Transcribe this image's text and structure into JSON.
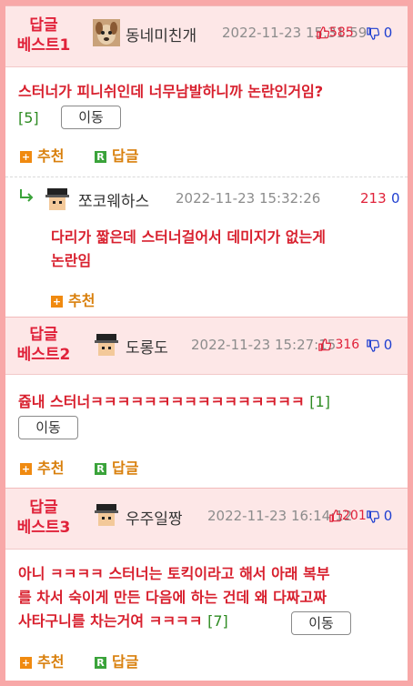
{
  "posts": [
    {
      "best_label_1": "답글",
      "best_label_2": "베스트1",
      "nickname": "동네미친개",
      "date": "2022-11-23 15:31:59",
      "up": "585",
      "down": "0",
      "text": "스터너가 피니쉬인데 너무남발하니까 논란인거임?",
      "reply_count": "[5]",
      "move_label": "이동",
      "recommend_label": "추천",
      "reply_label": "답글"
    },
    {
      "nickname": "쪼코웨하스",
      "date": "2022-11-23 15:32:26",
      "up": "213",
      "down": "0",
      "text_line1": "다리가 짧은데 스터너걸어서 데미지가 없는게",
      "text_line2": "논란임",
      "recommend_label": "추천"
    },
    {
      "best_label_1": "답글",
      "best_label_2": "베스트2",
      "nickname": "도롱도",
      "date": "2022-11-23 15:27:15",
      "up": "316",
      "down": "0",
      "text": "쥽내 스터너ㅋㅋㅋㅋㅋㅋㅋㅋㅋㅋㅋㅋㅋㅋㅋㅋ",
      "reply_count": "[1]",
      "move_label": "이동",
      "recommend_label": "추천",
      "reply_label": "답글"
    },
    {
      "best_label_1": "답글",
      "best_label_2": "베스트3",
      "nickname": "우주일짱",
      "date": "2022-11-23 16:14:12",
      "up": "201",
      "down": "0",
      "text_line1": "아니 ㅋㅋㅋㅋ 스터너는 토킥이라고 해서 아래 복부",
      "text_line2": "를 차서 숙이게 만든 다음에 하는 건데 왜 다짜고짜",
      "text_line3": "사타구니를 차는거여 ㅋㅋㅋㅋ",
      "reply_count": "[7]",
      "move_label": "이동",
      "recommend_label": "추천",
      "reply_label": "답글"
    }
  ],
  "colors": {
    "accent_red": "#e0223a",
    "downvote_blue": "#1f3fd0",
    "count_green": "#2e8b22",
    "recommend_orange": "#d9800d",
    "header_pink": "#fde7e7",
    "border_pink": "#f8a8a8"
  },
  "icons": {
    "up": "thumbs-up-icon",
    "down": "thumbs-down-icon",
    "recommend": "plus-icon",
    "reply": "reply-r-icon",
    "reply_arrow": "reply-arrow-icon"
  }
}
